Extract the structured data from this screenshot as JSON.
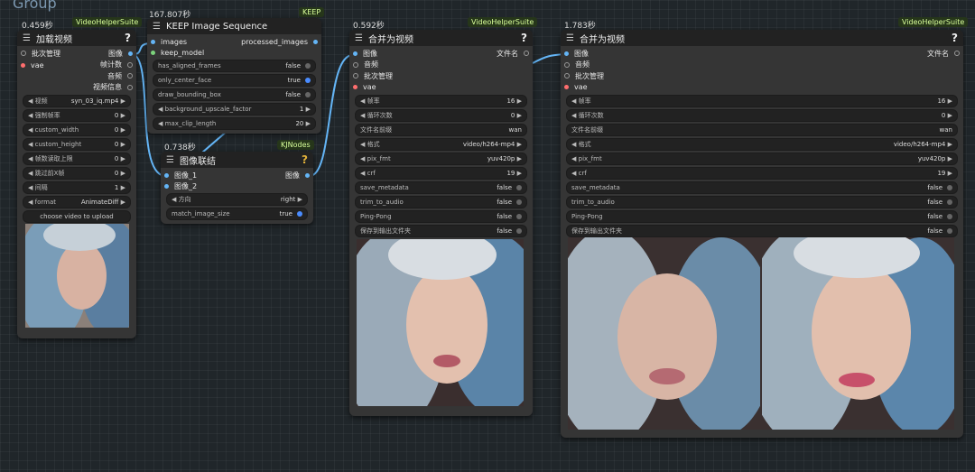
{
  "group": {
    "title": "Group"
  },
  "nodes": {
    "load": {
      "time": "0.459秒",
      "badge": "VideoHelperSuite",
      "title": "加载视频",
      "help": "?",
      "inputs": [
        "批次管理",
        "vae"
      ],
      "outputs": [
        "图像",
        "帧计数",
        "音频",
        "视频信息"
      ],
      "widgets": [
        {
          "label": "视频",
          "value": "syn_03_iq.mp4",
          "kind": "combo"
        },
        {
          "label": "强制帧率",
          "value": "0",
          "kind": "num"
        },
        {
          "label": "custom_width",
          "value": "0",
          "kind": "num"
        },
        {
          "label": "custom_height",
          "value": "0",
          "kind": "num"
        },
        {
          "label": "帧数读取上限",
          "value": "0",
          "kind": "num"
        },
        {
          "label": "跳过前X帧",
          "value": "0",
          "kind": "num"
        },
        {
          "label": "间隔",
          "value": "1",
          "kind": "num"
        },
        {
          "label": "format",
          "value": "AnimateDiff",
          "kind": "combo"
        }
      ],
      "upload_label": "choose video to upload"
    },
    "keep": {
      "time": "167.807秒",
      "badge": "KEEP",
      "title": "KEEP Image Sequence",
      "inputs": [
        "images",
        "keep_model"
      ],
      "outputs": [
        "processed_images"
      ],
      "widgets": [
        {
          "label": "has_aligned_frames",
          "value": "false",
          "kind": "toggle",
          "on": false
        },
        {
          "label": "only_center_face",
          "value": "true",
          "kind": "toggle",
          "on": true
        },
        {
          "label": "draw_bounding_box",
          "value": "false",
          "kind": "toggle",
          "on": false
        },
        {
          "label": "background_upscale_factor",
          "value": "1",
          "kind": "num"
        },
        {
          "label": "max_clip_length",
          "value": "20",
          "kind": "num"
        }
      ]
    },
    "concat": {
      "time": "0.738秒",
      "badge": "KJNodes",
      "title": "图像联结",
      "help": "?",
      "inputs": [
        "图像_1",
        "图像_2"
      ],
      "outputs": [
        "图像"
      ],
      "widgets": [
        {
          "label": "方向",
          "value": "right",
          "kind": "combo"
        },
        {
          "label": "match_image_size",
          "value": "true",
          "kind": "toggle",
          "on": true
        }
      ]
    },
    "merge1": {
      "time": "0.592秒",
      "badge": "VideoHelperSuite",
      "title": "合并为视频",
      "help": "?",
      "inputs": [
        "图像",
        "音频",
        "批次管理",
        "vae"
      ],
      "outputs": [
        "文件名"
      ],
      "widgets": [
        {
          "label": "帧率",
          "value": "16",
          "kind": "num"
        },
        {
          "label": "循环次数",
          "value": "0",
          "kind": "num"
        },
        {
          "label": "文件名前缀",
          "value": "wan",
          "kind": "text"
        },
        {
          "label": "格式",
          "value": "video/h264-mp4",
          "kind": "combo"
        },
        {
          "label": "pix_fmt",
          "value": "yuv420p",
          "kind": "combo"
        },
        {
          "label": "crf",
          "value": "19",
          "kind": "num"
        },
        {
          "label": "save_metadata",
          "value": "false",
          "kind": "toggle",
          "on": false
        },
        {
          "label": "trim_to_audio",
          "value": "false",
          "kind": "toggle",
          "on": false
        },
        {
          "label": "Ping-Pong",
          "value": "false",
          "kind": "toggle",
          "on": false
        },
        {
          "label": "保存到输出文件夹",
          "value": "false",
          "kind": "toggle",
          "on": false
        }
      ]
    },
    "merge2": {
      "time": "1.783秒",
      "badge": "VideoHelperSuite",
      "title": "合并为视频",
      "help": "?",
      "inputs": [
        "图像",
        "音频",
        "批次管理",
        "vae"
      ],
      "outputs": [
        "文件名"
      ],
      "widgets": [
        {
          "label": "帧率",
          "value": "16",
          "kind": "num"
        },
        {
          "label": "循环次数",
          "value": "0",
          "kind": "num"
        },
        {
          "label": "文件名前缀",
          "value": "wan",
          "kind": "text"
        },
        {
          "label": "格式",
          "value": "video/h264-mp4",
          "kind": "combo"
        },
        {
          "label": "pix_fmt",
          "value": "yuv420p",
          "kind": "combo"
        },
        {
          "label": "crf",
          "value": "19",
          "kind": "num"
        },
        {
          "label": "save_metadata",
          "value": "false",
          "kind": "toggle",
          "on": false
        },
        {
          "label": "trim_to_audio",
          "value": "false",
          "kind": "toggle",
          "on": false
        },
        {
          "label": "Ping-Pong",
          "value": "false",
          "kind": "toggle",
          "on": false
        },
        {
          "label": "保存到输出文件夹",
          "value": "false",
          "kind": "toggle",
          "on": false
        }
      ]
    }
  },
  "colors": {
    "image_link": "#64b5f6",
    "vae": "#ff6e6e",
    "model": "#7cd37c",
    "toggle_on": "#4a8cff",
    "badge_text": "#d8ff9a"
  },
  "icons": {
    "menu": "hamburger-icon",
    "help": "question-icon",
    "arrow_left": "chevron-left-icon",
    "arrow_right": "chevron-right-icon"
  }
}
